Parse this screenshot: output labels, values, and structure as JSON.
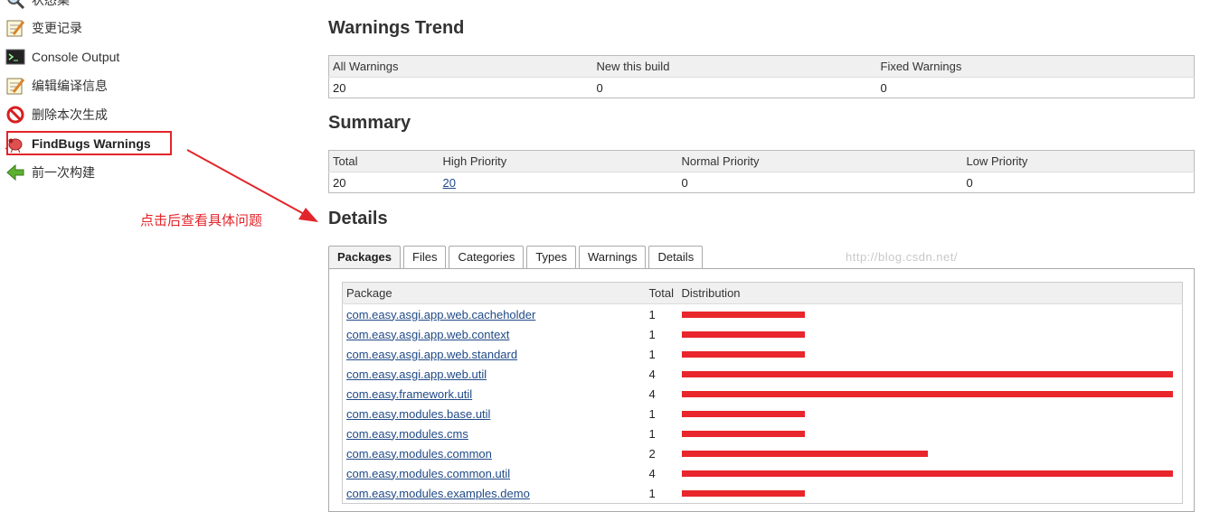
{
  "sidebar": {
    "items": [
      {
        "label": "状态集",
        "icon": "magnifier-icon"
      },
      {
        "label": "变更记录",
        "icon": "notepad-icon"
      },
      {
        "label": "Console Output",
        "icon": "terminal-icon"
      },
      {
        "label": "编辑编译信息",
        "icon": "notepad-icon"
      },
      {
        "label": "删除本次生成",
        "icon": "no-entry-icon"
      },
      {
        "label": "FindBugs Warnings",
        "icon": "bug-icon"
      },
      {
        "label": "前一次构建",
        "icon": "left-arrow-icon"
      }
    ],
    "annotation": "点击后查看具体问题"
  },
  "warnings_trend": {
    "title": "Warnings Trend",
    "headers": [
      "All Warnings",
      "New this build",
      "Fixed Warnings"
    ],
    "values": [
      "20",
      "0",
      "0"
    ]
  },
  "summary": {
    "title": "Summary",
    "headers": [
      "Total",
      "High Priority",
      "Normal Priority",
      "Low Priority"
    ],
    "values": [
      "20",
      "20",
      "0",
      "0"
    ]
  },
  "details": {
    "title": "Details",
    "tabs": [
      "Packages",
      "Files",
      "Categories",
      "Types",
      "Warnings",
      "Details"
    ],
    "watermark": "http://blog.csdn.net/",
    "table": {
      "headers": [
        "Package",
        "Total",
        "Distribution"
      ],
      "max_total": 4,
      "rows": [
        {
          "package": "com.easy.asgi.app.web.cacheholder",
          "total": 1
        },
        {
          "package": "com.easy.asgi.app.web.context",
          "total": 1
        },
        {
          "package": "com.easy.asgi.app.web.standard",
          "total": 1
        },
        {
          "package": "com.easy.asgi.app.web.util",
          "total": 4
        },
        {
          "package": "com.easy.framework.util",
          "total": 4
        },
        {
          "package": "com.easy.modules.base.util",
          "total": 1
        },
        {
          "package": "com.easy.modules.cms",
          "total": 1
        },
        {
          "package": "com.easy.modules.common",
          "total": 2
        },
        {
          "package": "com.easy.modules.common.util",
          "total": 4
        },
        {
          "package": "com.easy.modules.examples.demo",
          "total": 1
        }
      ]
    }
  },
  "colors": {
    "bar": "#e8262c",
    "annotation": "#e2252b"
  }
}
